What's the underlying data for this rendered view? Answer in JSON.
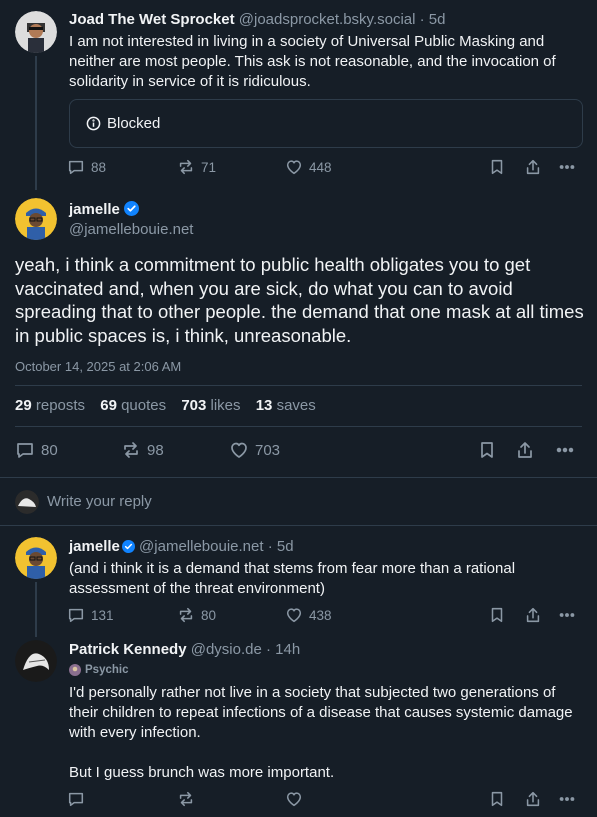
{
  "parent_post": {
    "display_name": "Joad The Wet Sprocket",
    "handle": "@joadsprocket.bsky.social",
    "time": "· 5d",
    "text": "I am not interested in living in a society of Universal Public Masking and neither are most people. This ask is not reasonable, and the invocation of solidarity in service of it is ridiculous.",
    "embed_label": "Blocked",
    "replies": "88",
    "reposts": "71",
    "likes": "448"
  },
  "main_post": {
    "display_name": "jamelle",
    "handle": "@jamellebouie.net",
    "text": "yeah, i think a commitment to public health obligates you to get vaccinated and, when you are sick, do what you can to avoid spreading that to other people. the demand that one mask at all times in public spaces is, i think, unreasonable.",
    "timestamp": "October 14, 2025 at 2:06 AM",
    "stats": {
      "reposts_count": "29",
      "reposts_label": "reposts",
      "quotes_count": "69",
      "quotes_label": "quotes",
      "likes_count": "703",
      "likes_label": "likes",
      "saves_count": "13",
      "saves_label": "saves"
    },
    "replies": "80",
    "reposts": "98",
    "likes": "703"
  },
  "reply_box": {
    "placeholder": "Write your reply"
  },
  "replies": [
    {
      "display_name": "jamelle",
      "handle": "@jamellebouie.net",
      "time": "· 5d",
      "text": "(and i think it is a demand that stems from fear more than a rational assessment of the threat environment)",
      "replies": "131",
      "reposts": "80",
      "likes": "438"
    },
    {
      "display_name": "Patrick Kennedy",
      "handle": "@dysio.de",
      "time": "· 14h",
      "label": "Psychic",
      "text": "I'd personally rather not live in a society that subjected two generations of their children to repeat infections of a disease that causes systemic damage with every infection.\n\nBut I guess brunch was more important.",
      "replies": "",
      "reposts": "",
      "likes": ""
    }
  ],
  "colors": {
    "background": "#161e27",
    "divider": "#2e3c4a",
    "muted_text": "#8b98a5",
    "verified": "#1083fe"
  },
  "icons": [
    "reply-icon",
    "repost-icon",
    "like-icon",
    "bookmark-icon",
    "share-icon",
    "more-icon",
    "info-icon",
    "verified-badge-icon"
  ]
}
